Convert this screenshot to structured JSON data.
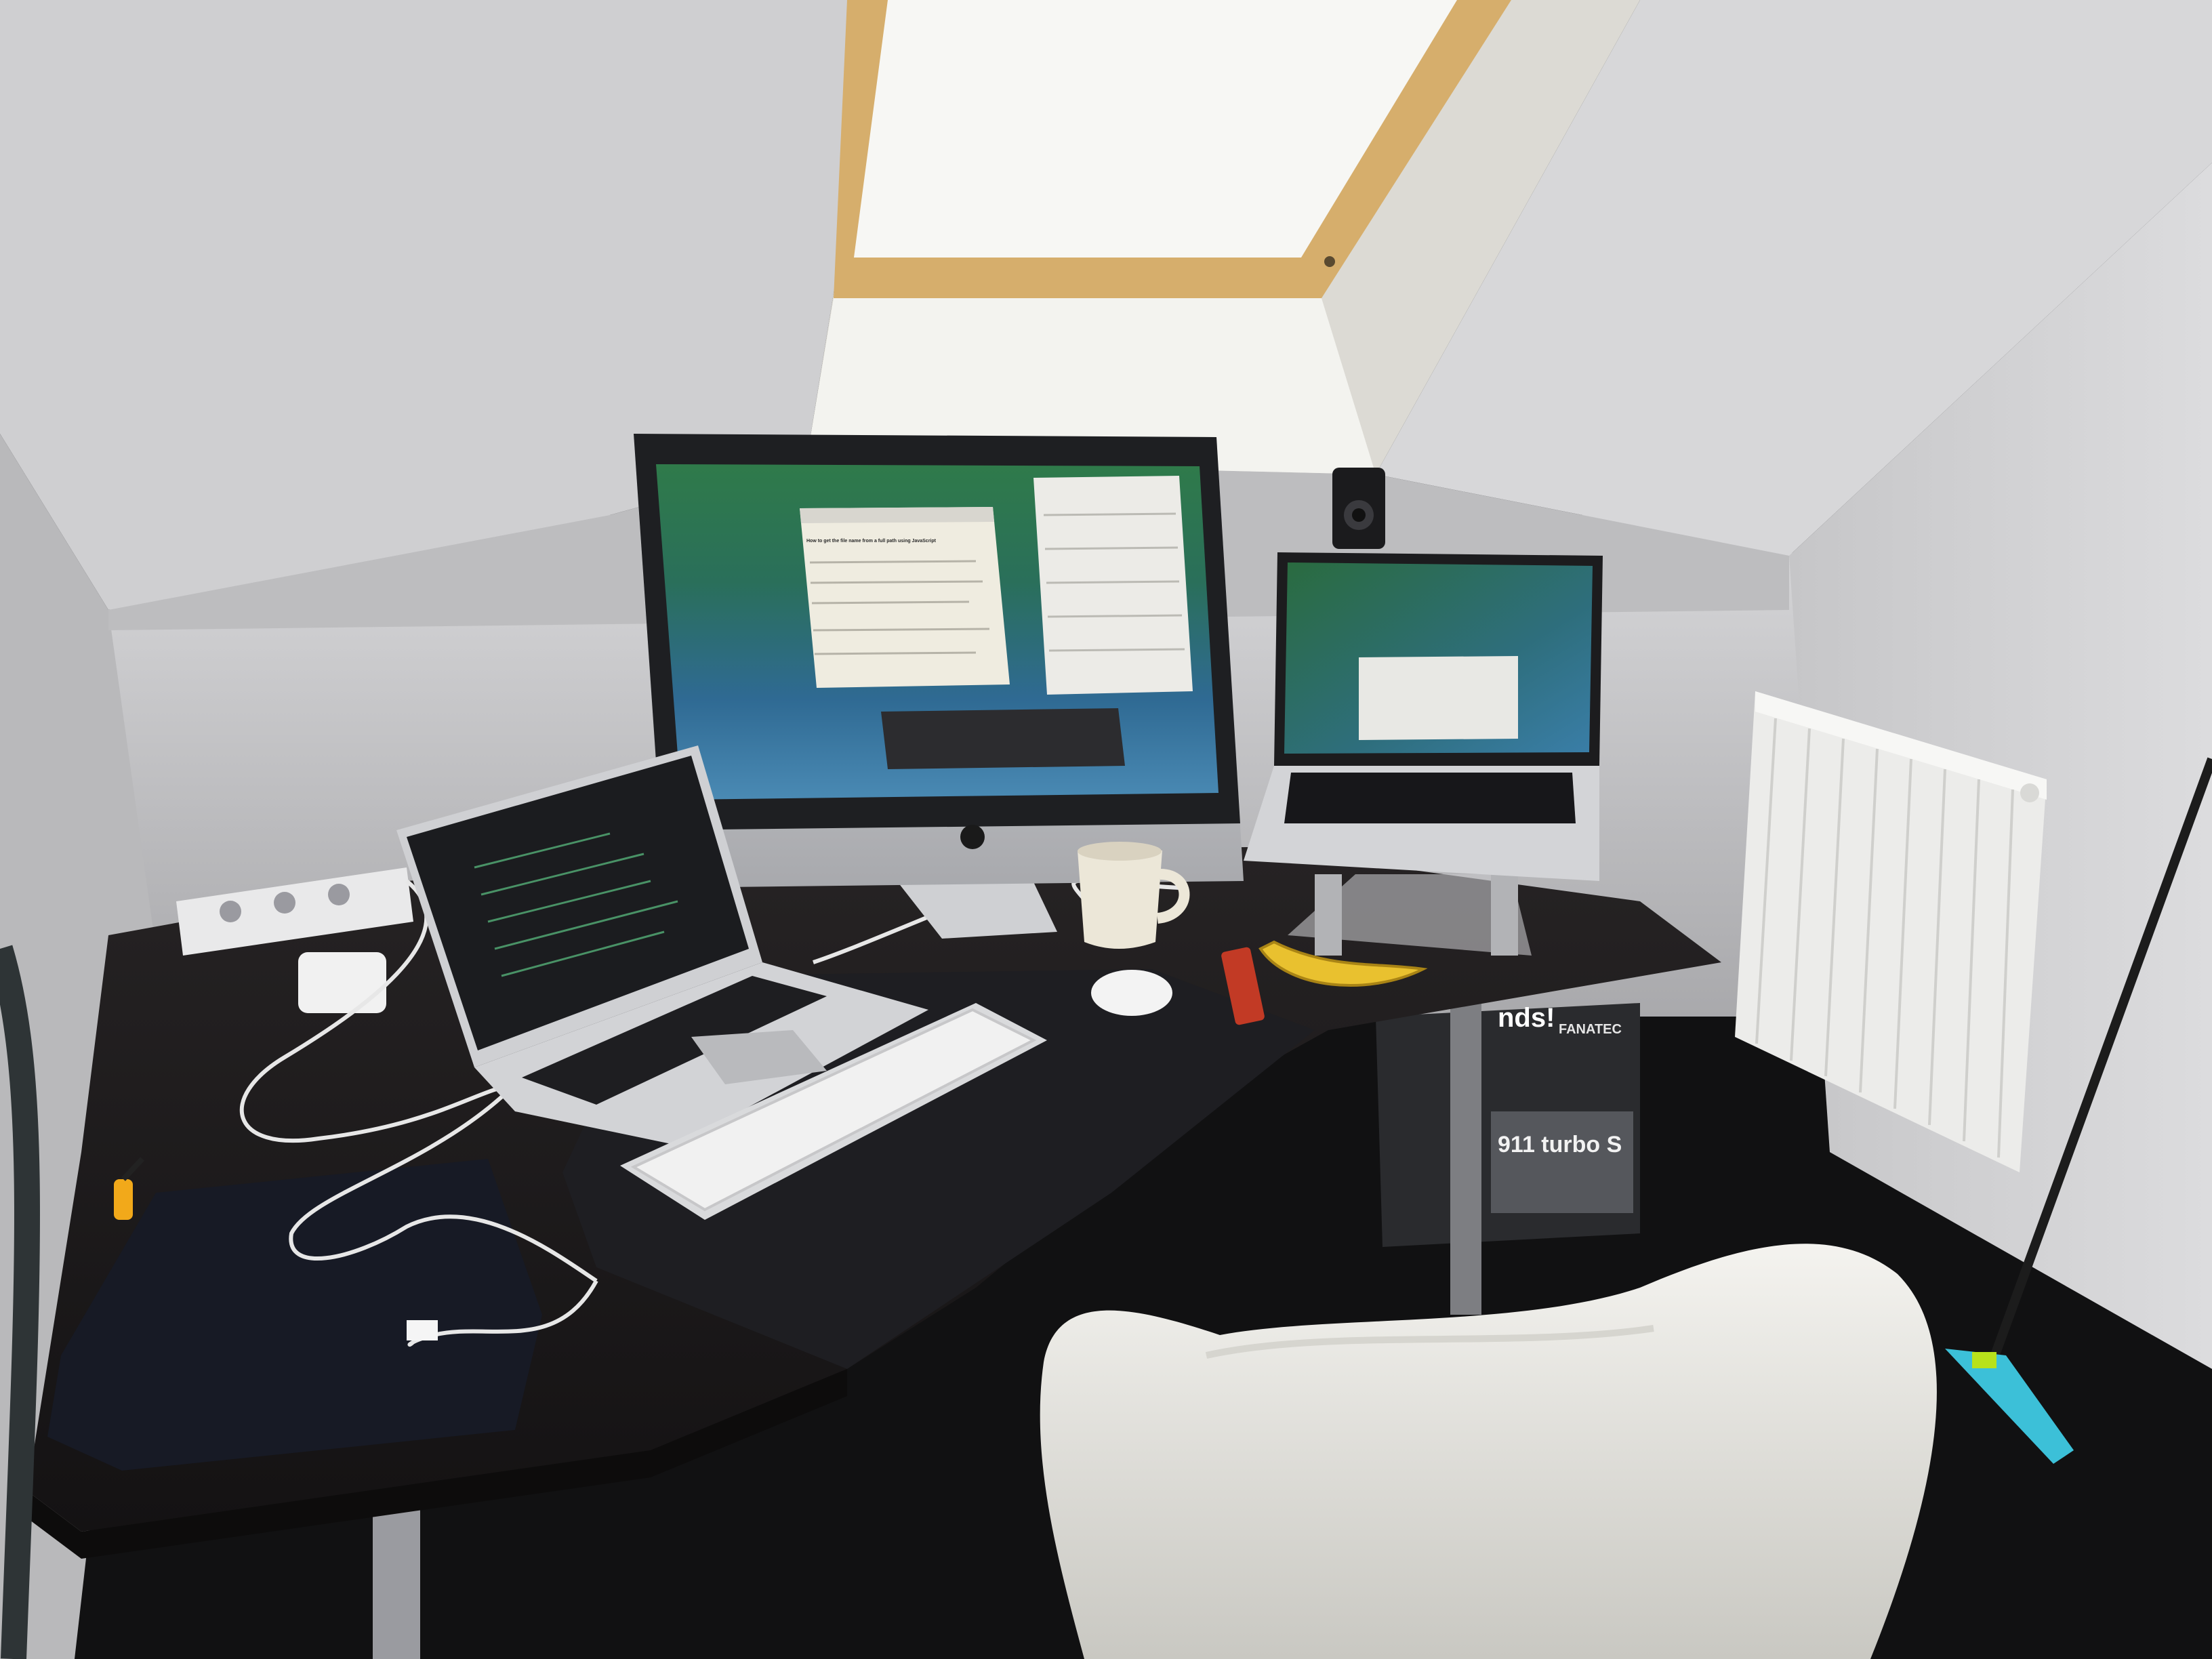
{
  "scene": {
    "colors": {
      "wall": "#c9c9cb",
      "ceiling": "#d4d4d6",
      "skylight": "#f6f6f3",
      "window_frame": "#d6ae6c",
      "desk": "#1d1b1c",
      "floor": "#121213",
      "chair": "#ecebe6",
      "radiator": "#eeeeec",
      "wallpaper_green": "#2f7a4a",
      "wallpaper_blue": "#2f6a93",
      "aluminum": "#c4c5c8",
      "banana": "#e9c12f",
      "mop_head": "#3cc0d8"
    },
    "objects": [
      "skylight-window",
      "imac-27",
      "macbook-pro-left",
      "macbook-pro-on-stand",
      "apple-keyboard",
      "magic-mouse",
      "coffee-mug",
      "banana",
      "usb-stick",
      "power-strip",
      "power-adapter",
      "laptop-sleeve",
      "screwdriver",
      "speaker",
      "radiator",
      "white-chair",
      "mop",
      "game-box"
    ],
    "printed_text": {
      "monitor_heading": "How to get the file name from a full path using JavaScript",
      "box_brand": "FANATEC",
      "box_model": "911 turbo S",
      "box_top": "nds!"
    }
  }
}
